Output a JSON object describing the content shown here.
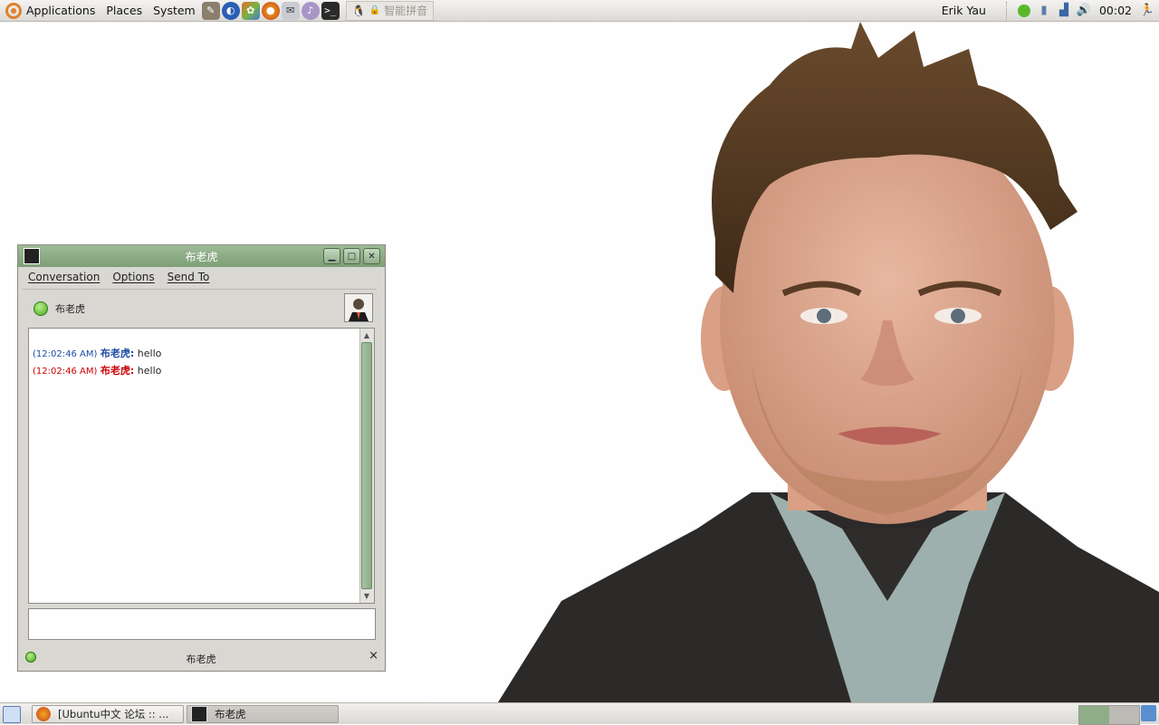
{
  "top_panel": {
    "menus": [
      "Applications",
      "Places",
      "System"
    ],
    "launchers": [
      "gimp-icon",
      "web-browser-icon",
      "graphics-icon",
      "firefox-icon",
      "mail-icon",
      "pidgin-icon",
      "terminal-icon"
    ],
    "ime_label": "智能拼音",
    "user": "Erik Yau",
    "clock": "00:02"
  },
  "chat_window": {
    "title": "布老虎",
    "menu": [
      "Conversation",
      "Options",
      "Send To"
    ],
    "buddy_name": "布老虎",
    "messages": [
      {
        "time": "(12:02:46 AM)",
        "sender": "布老虎:",
        "text": "hello",
        "color": "#1c4aa3"
      },
      {
        "time": "(12:02:46 AM)",
        "sender": "布老虎:",
        "text": "hello",
        "color": "#cc0000"
      }
    ],
    "input_value": "",
    "status_name": "布老虎",
    "close_tab": "×"
  },
  "taskbar": {
    "tasks": [
      "[Ubuntu中文 论坛 :: ...",
      "布老虎"
    ]
  },
  "colors": {
    "titlebar": "#86a781",
    "panel": "#e6e4e0",
    "status_green": "#4aa81c"
  }
}
